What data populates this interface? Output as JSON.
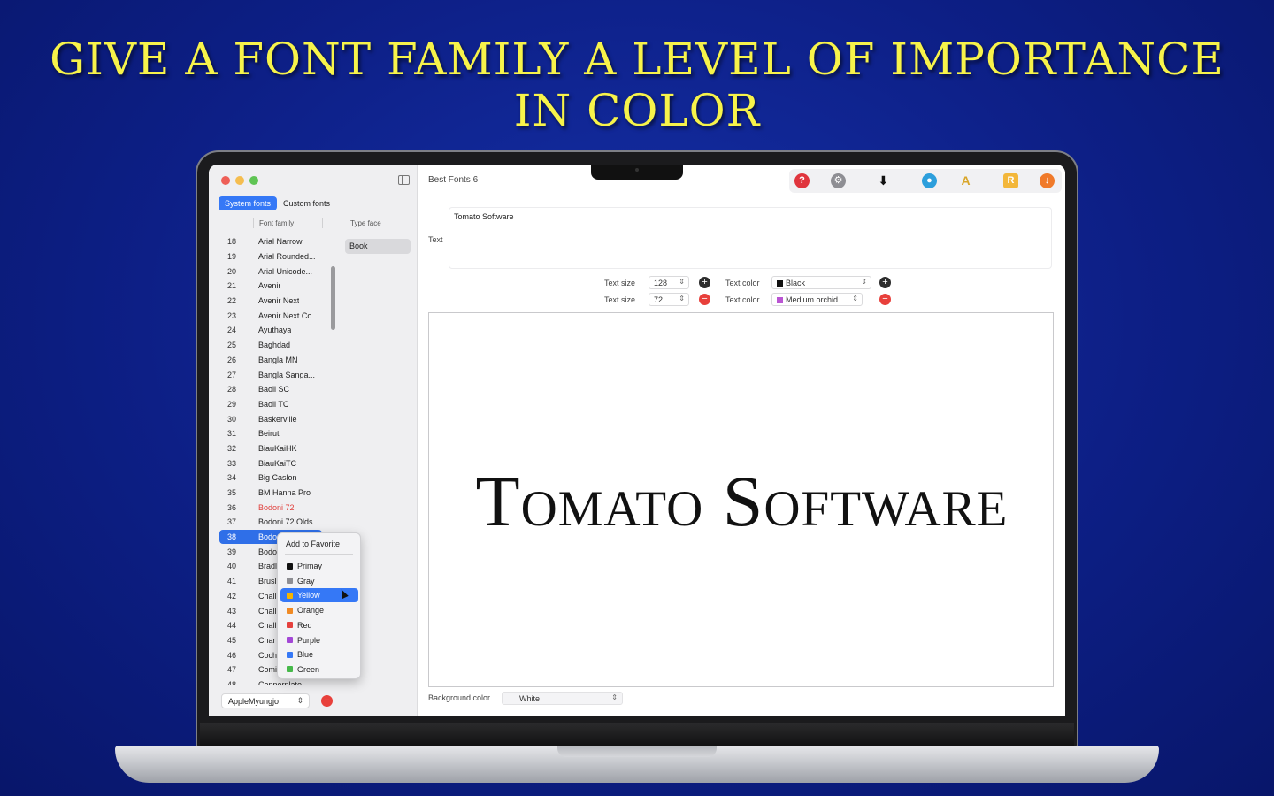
{
  "headline": {
    "line1": "GIVE A FONT FAMILY A LEVEL OF IMPORTANCE",
    "line2": "IN COLOR"
  },
  "window": {
    "title": "Best Fonts 6"
  },
  "sidebar": {
    "tabs": [
      {
        "label": "System fonts",
        "active": true
      },
      {
        "label": "Custom fonts",
        "active": false
      }
    ],
    "columns": {
      "family": "Font family",
      "typeface": "Type face"
    },
    "fonts": [
      {
        "num": "18",
        "name": "Arial Narrow"
      },
      {
        "num": "19",
        "name": "Arial Rounded..."
      },
      {
        "num": "20",
        "name": "Arial Unicode..."
      },
      {
        "num": "21",
        "name": "Avenir"
      },
      {
        "num": "22",
        "name": "Avenir Next"
      },
      {
        "num": "23",
        "name": "Avenir Next Co..."
      },
      {
        "num": "24",
        "name": "Ayuthaya"
      },
      {
        "num": "25",
        "name": "Baghdad"
      },
      {
        "num": "26",
        "name": "Bangla MN"
      },
      {
        "num": "27",
        "name": "Bangla Sanga..."
      },
      {
        "num": "28",
        "name": "Baoli SC"
      },
      {
        "num": "29",
        "name": "Baoli TC"
      },
      {
        "num": "30",
        "name": "Baskerville"
      },
      {
        "num": "31",
        "name": "Beirut"
      },
      {
        "num": "32",
        "name": "BiauKaiHK"
      },
      {
        "num": "33",
        "name": "BiauKaiTC"
      },
      {
        "num": "34",
        "name": "Big Caslon"
      },
      {
        "num": "35",
        "name": "BM Hanna Pro"
      },
      {
        "num": "36",
        "name": "Bodoni 72",
        "color": "red"
      },
      {
        "num": "37",
        "name": "Bodoni 72 Olds..."
      },
      {
        "num": "38",
        "name": "Bodo",
        "selected": true
      },
      {
        "num": "39",
        "name": "Bodo"
      },
      {
        "num": "40",
        "name": "Bradl"
      },
      {
        "num": "41",
        "name": "Brusl"
      },
      {
        "num": "42",
        "name": "Chall"
      },
      {
        "num": "43",
        "name": "Chall"
      },
      {
        "num": "44",
        "name": "Chall"
      },
      {
        "num": "45",
        "name": "Char"
      },
      {
        "num": "46",
        "name": "Coch"
      },
      {
        "num": "47",
        "name": "Comi"
      },
      {
        "num": "48",
        "name": "Copperplate"
      }
    ],
    "typeface": "Book",
    "bottom_select": "AppleMyungjo"
  },
  "context_menu": {
    "title": "Add to Favorite",
    "items": [
      {
        "label": "Primay",
        "color": "#111111"
      },
      {
        "label": "Gray",
        "color": "#8e8e93"
      },
      {
        "label": "Yellow",
        "color": "#f5b400",
        "highlighted": true
      },
      {
        "label": "Orange",
        "color": "#f08a24"
      },
      {
        "label": "Red",
        "color": "#e5403d"
      },
      {
        "label": "Purple",
        "color": "#a347d6"
      },
      {
        "label": "Blue",
        "color": "#3578f6"
      },
      {
        "label": "Green",
        "color": "#46b94a"
      }
    ]
  },
  "toolbar": {
    "icons": [
      {
        "name": "help-icon",
        "glyph": "?",
        "color": "#e0353d"
      },
      {
        "name": "settings-icon",
        "glyph": "⚙",
        "color": "#8e8e93"
      },
      {
        "name": "export-document-icon",
        "glyph": "⬇",
        "color": "#111111"
      },
      {
        "name": "color-drop-icon",
        "glyph": "●",
        "color": "#2d9fdc"
      },
      {
        "name": "font-a-icon",
        "glyph": "A",
        "color": "#d9a62a"
      },
      {
        "name": "rate-icon",
        "glyph": "R",
        "color": "#f3b73a"
      },
      {
        "name": "download-icon",
        "glyph": "↓",
        "color": "#f07a2a"
      }
    ]
  },
  "editor": {
    "text_label": "Text",
    "text_value": "Tomato Software",
    "rows": [
      {
        "size_label": "Text size",
        "size": "128",
        "color_label": "Text color",
        "color_name": "Black",
        "swatch": "#111111",
        "action": "add"
      },
      {
        "size_label": "Text size",
        "size": "72",
        "color_label": "Text color",
        "color_name": "Medium orchid",
        "swatch": "#ba55d3",
        "action": "remove"
      }
    ],
    "preview_text": "Tomato Software",
    "background_label": "Background color",
    "background_value": "White"
  },
  "colors": {
    "accent": "#3578f6",
    "headline": "#f7f34a",
    "background": "#0d1f86"
  }
}
